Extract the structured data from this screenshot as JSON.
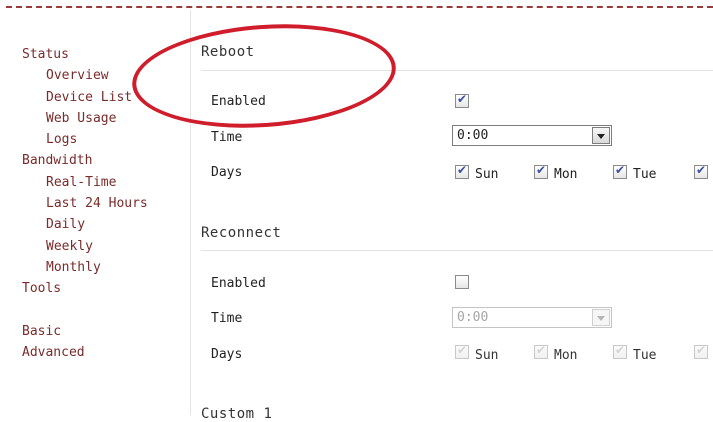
{
  "sidebar": {
    "items": [
      {
        "label": "Status",
        "level": "group"
      },
      {
        "label": "Overview",
        "level": "sub"
      },
      {
        "label": "Device List",
        "level": "sub"
      },
      {
        "label": "Web Usage",
        "level": "sub"
      },
      {
        "label": "Logs",
        "level": "sub"
      },
      {
        "label": "Bandwidth",
        "level": "group"
      },
      {
        "label": "Real-Time",
        "level": "sub"
      },
      {
        "label": "Last 24 Hours",
        "level": "sub"
      },
      {
        "label": "Daily",
        "level": "sub"
      },
      {
        "label": "Weekly",
        "level": "sub"
      },
      {
        "label": "Monthly",
        "level": "sub"
      },
      {
        "label": "Tools",
        "level": "group"
      },
      {
        "label": "Basic",
        "level": "group"
      },
      {
        "label": "Advanced",
        "level": "group"
      }
    ]
  },
  "reboot": {
    "title": "Reboot",
    "enabled_label": "Enabled",
    "enabled": true,
    "time_label": "Time",
    "time_value": "0:00",
    "days_label": "Days",
    "days": [
      {
        "label": "Sun",
        "checked": true
      },
      {
        "label": "Mon",
        "checked": true
      },
      {
        "label": "Tue",
        "checked": true
      },
      {
        "label": "",
        "checked": true
      }
    ]
  },
  "reconnect": {
    "title": "Reconnect",
    "enabled_label": "Enabled",
    "enabled": false,
    "time_label": "Time",
    "time_value": "0:00",
    "days_label": "Days",
    "days": [
      {
        "label": "Sun",
        "checked": true
      },
      {
        "label": "Mon",
        "checked": true
      },
      {
        "label": "Tue",
        "checked": true
      },
      {
        "label": "",
        "checked": true
      }
    ]
  },
  "custom": {
    "title": "Custom 1"
  },
  "annotation_color": "#d01d2b",
  "link_color": "#7a2b2b"
}
